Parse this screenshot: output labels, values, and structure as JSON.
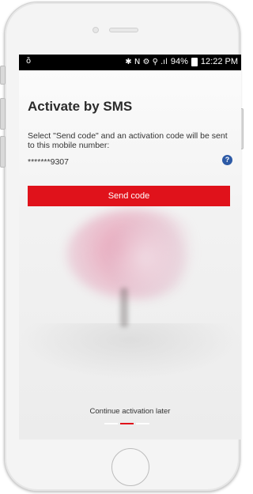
{
  "statusbar": {
    "left_icon": "ȍ",
    "right_glyphs": "✱ N ⚙ ⚲ .ıl",
    "battery_percent": "94%",
    "time": "12:22 PM"
  },
  "screen": {
    "title": "Activate by SMS",
    "description": "Select \"Send code\" and an activation code will be sent to this mobile number:",
    "phone_number": "*******9307",
    "help_icon_label": "?",
    "send_button_label": "Send code",
    "continue_later_label": "Continue activation later",
    "pager": {
      "count": 3,
      "active_index": 1
    }
  },
  "colors": {
    "accent": "#e0121b",
    "help_icon": "#2d5aa6"
  }
}
